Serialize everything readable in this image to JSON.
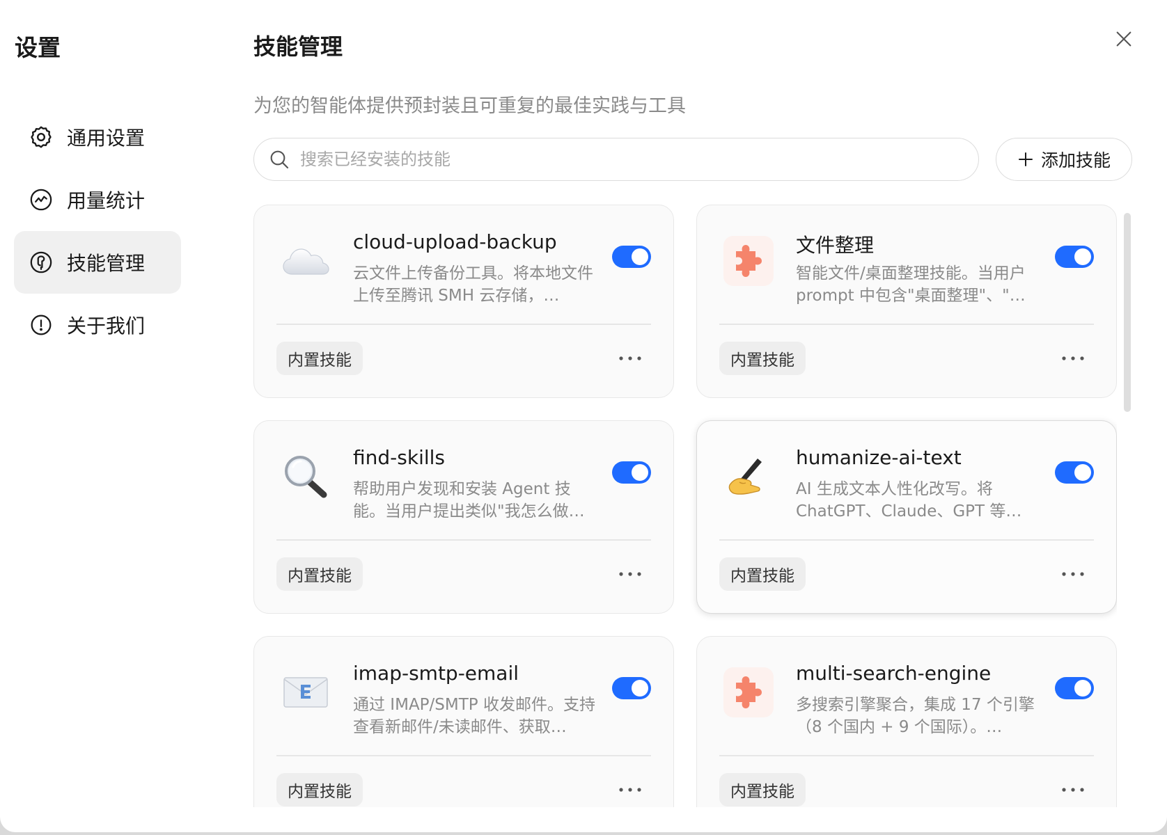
{
  "sidebar": {
    "title": "设置",
    "items": [
      {
        "label": "通用设置",
        "icon": "gear-icon"
      },
      {
        "label": "用量统计",
        "icon": "usage-chart-icon"
      },
      {
        "label": "技能管理",
        "icon": "skills-icon",
        "active": true
      },
      {
        "label": "关于我们",
        "icon": "info-icon"
      }
    ]
  },
  "main": {
    "title": "技能管理",
    "subtitle": "为您的智能体提供预封装且可重复的最佳实践与工具",
    "search": {
      "placeholder": "搜索已经安装的技能",
      "value": ""
    },
    "add_button": "添加技能"
  },
  "skills": [
    {
      "name": "cloud-upload-backup",
      "desc": "云文件上传备份工具。将本地文件上传至腾讯 SMH 云存储，…",
      "badge": "内置技能",
      "enabled": true,
      "icon": "cloud-icon"
    },
    {
      "name": "文件整理",
      "desc": "智能文件/桌面整理技能。当用户 prompt 中包含\"桌面整理\"、\"…",
      "badge": "内置技能",
      "enabled": true,
      "icon": "puzzle-icon"
    },
    {
      "name": "find-skills",
      "desc": "帮助用户发现和安装 Agent 技能。当用户提出类似\"我怎么做…",
      "badge": "内置技能",
      "enabled": true,
      "icon": "magnifier-icon"
    },
    {
      "name": "humanize-ai-text",
      "desc": "AI 生成文本人性化改写。将 ChatGPT、Claude、GPT 等…",
      "badge": "内置技能",
      "enabled": true,
      "icon": "writing-hand-icon"
    },
    {
      "name": "imap-smtp-email",
      "desc": "通过 IMAP/SMTP 收发邮件。支持查看新邮件/未读邮件、获取…",
      "badge": "内置技能",
      "enabled": true,
      "icon": "email-icon"
    },
    {
      "name": "multi-search-engine",
      "desc": "多搜索引擎聚合，集成 17 个引擎（8 个国内 + 9 个国际）。…",
      "badge": "内置技能",
      "enabled": true,
      "icon": "puzzle-icon"
    }
  ],
  "colors": {
    "accent": "#1f6bff",
    "puzzle": "#f5846b"
  }
}
